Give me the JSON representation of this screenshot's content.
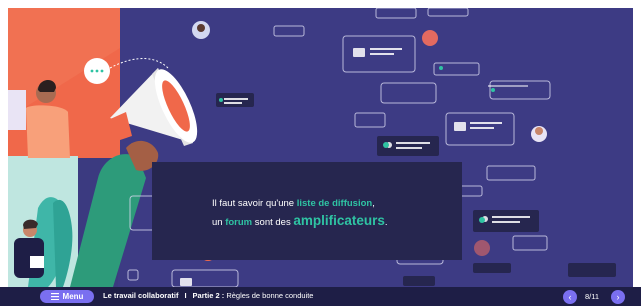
{
  "slide": {
    "text_line1_before": "Il faut savoir qu'une ",
    "text_highlight1": "liste de diffusion",
    "text_line1_after": ",",
    "text_line2_before": "un ",
    "text_highlight2": "forum",
    "text_line2_middle": " sont des ",
    "text_highlight3": "amplificateurs",
    "text_line2_after": "."
  },
  "bottom_bar": {
    "menu_label": "Menu",
    "course_title": "Le travail collaboratif",
    "separator": "I",
    "part_label": "Partie 2 :",
    "part_title": "Règles de bonne conduite",
    "page_indicator": "8/11"
  },
  "icons": {
    "menu": "hamburger-icon",
    "prev": "chevron-left-icon",
    "next": "chevron-right-icon"
  },
  "colors": {
    "background": "#3a3a7e",
    "accent": "#2fc3a3",
    "button": "#7a6ff0",
    "bar": "#1e1e46",
    "orange_panel": "#f06a4c"
  }
}
